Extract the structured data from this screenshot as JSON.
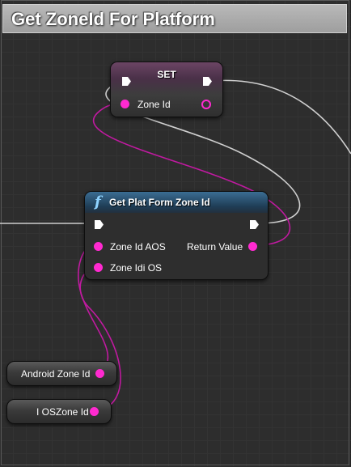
{
  "comment": {
    "title": "Get ZoneId For Platform"
  },
  "set_node": {
    "title": "SET",
    "input_label": "Zone Id"
  },
  "function_node": {
    "icon": "f",
    "title": "Get Plat Form Zone Id",
    "inputs": [
      "Zone Id AOS",
      "Zone Idi OS"
    ],
    "output_label": "Return Value"
  },
  "variables": [
    {
      "label": "Android Zone Id"
    },
    {
      "label": "I OSZone Id"
    }
  ],
  "colors": {
    "pin_data": "#ff2ad0",
    "exec_wire": "#cfcfcf",
    "function_header": "#3b6d93"
  }
}
